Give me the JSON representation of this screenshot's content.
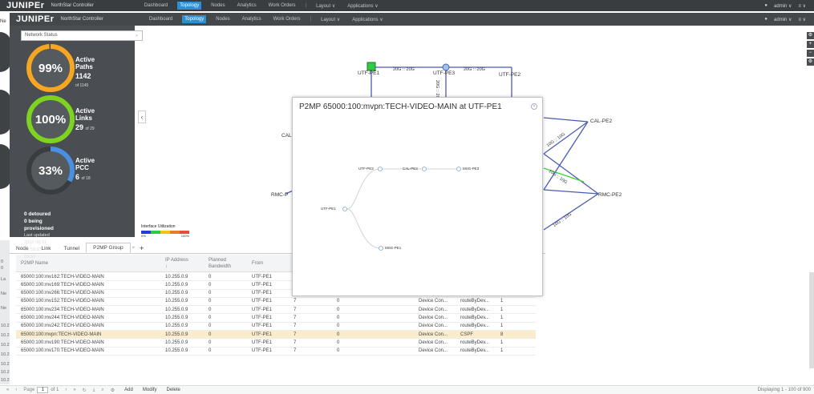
{
  "app": {
    "brand": "JUNIPEr",
    "brand_sub": "NorthStar Controller",
    "nav": [
      "Dashboard",
      "Topology",
      "Nodes",
      "Analytics",
      "Work Orders"
    ],
    "nav_active": "Topology",
    "layout_menu": "Layout ∨",
    "applications_menu": "Applications ∨",
    "user": "admin ∨",
    "menu_icon": "≡ ∨",
    "back_left_stub": "Ne"
  },
  "left_panel": {
    "select_label": "Network Status",
    "gauges": [
      {
        "pct_text": "99%",
        "pct": 99,
        "color": "#f5a623",
        "title": "Active Paths",
        "value": "1142",
        "of": "of 1145"
      },
      {
        "pct_text": "100%",
        "pct": 100,
        "color": "#7ed321",
        "title": "Active Links",
        "value": "29",
        "of": "of 29"
      },
      {
        "pct_text": "33%",
        "pct": 33,
        "color": "#4a90e2",
        "title": "Active PCC",
        "value": "6",
        "of": "of 18"
      }
    ],
    "detoured": "0 detoured",
    "provisioned": "0 being provisioned",
    "last_updated": "Last updated 2018-08-31 15:58:32 CEST"
  },
  "topology": {
    "nodes": [
      {
        "label": "UTF-PE1"
      },
      {
        "label": "UTF-PE3"
      },
      {
        "label": "UTF-PE2"
      },
      {
        "label": "CAL-PE2"
      },
      {
        "label": "RMC-PE2"
      },
      {
        "label": "CAL"
      },
      {
        "label": "RMC-P"
      }
    ],
    "link_labels": [
      "20G :: 20G",
      "20G :: 20G",
      "20G :: 20G",
      "10G :: 10G",
      "10G :: 10G",
      "10G :: 10G"
    ],
    "legend_title": "Interface Utilization",
    "legend_min": "0%",
    "legend_max": "100%",
    "legend_colors": [
      "#2b3bd6",
      "#2ecc40",
      "#f1c40f",
      "#e67e22",
      "#e74c3c"
    ]
  },
  "popup": {
    "title": "P2MP 65000:100:mvpn:TECH-VIDEO-MAIN at UTF-PE1",
    "tree": {
      "root": "UTF-PE1",
      "children": [
        "UTF-PE3",
        "CAL-PE3",
        "MSG-PE3",
        "MSG-PE1"
      ]
    }
  },
  "table": {
    "tabs": [
      "Node",
      "Link",
      "Tunnel",
      "P2MP Group"
    ],
    "add_tab": "+",
    "close_tab": "×",
    "columns": [
      "P2MP Name",
      "IP Address ↓",
      "Planned Bandwidth",
      "From"
    ],
    "rows": [
      [
        "65000:100:mv162:TECH-VIDEO-MAIN",
        "10.255.0.9",
        "0",
        "UTF-PE1",
        "",
        "",
        "",
        "",
        ""
      ],
      [
        "65000:100:mv169:TECH-VIDEO-MAIN",
        "10.255.0.9",
        "0",
        "UTF-PE1",
        "",
        "",
        "",
        "",
        ""
      ],
      [
        "65000:100:mv266:TECH-VIDEO-MAIN",
        "10.255.0.9",
        "0",
        "UTF-PE1",
        "7",
        "0",
        "Device Con...",
        "routeByDev...",
        "1"
      ],
      [
        "65000:100:mv152:TECH-VIDEO-MAIN",
        "10.255.0.9",
        "0",
        "UTF-PE1",
        "7",
        "0",
        "Device Con...",
        "routeByDev...",
        "1"
      ],
      [
        "65000:100:mv234:TECH-VIDEO-MAIN",
        "10.255.0.9",
        "0",
        "UTF-PE1",
        "7",
        "0",
        "Device Con...",
        "routeByDev...",
        "1"
      ],
      [
        "65000:100:mv244:TECH-VIDEO-MAIN",
        "10.255.0.9",
        "0",
        "UTF-PE1",
        "7",
        "0",
        "Device Con...",
        "routeByDev...",
        "1"
      ],
      [
        "65000:100:mv242:TECH-VIDEO-MAIN",
        "10.255.0.9",
        "0",
        "UTF-PE1",
        "7",
        "0",
        "Device Con...",
        "routeByDev...",
        "1"
      ],
      [
        "65000:100:mvpn:TECH-VIDEO-MAIN",
        "10.255.0.9",
        "0",
        "UTF-PE1",
        "7",
        "0",
        "Device Con...",
        "CSPF",
        "8"
      ],
      [
        "65000:100:mv190:TECH-VIDEO-MAIN",
        "10.255.0.9",
        "0",
        "UTF-PE1",
        "7",
        "0",
        "Device Con...",
        "routeByDev...",
        "1"
      ],
      [
        "65000:100:mv170:TECH-VIDEO-MAIN",
        "10.255.0.9",
        "0",
        "UTF-PE1",
        "7",
        "0",
        "Device Con...",
        "routeByDev...",
        "1"
      ]
    ],
    "selected_row": 7
  },
  "left_gutter": [
    "0",
    "0",
    "La",
    "Ne",
    "Ne",
    "10.2",
    "10.2",
    "10.2",
    "10.2",
    "10.2",
    "10.2",
    "10.2"
  ],
  "footer": {
    "page_label": "Page",
    "page_value": "1",
    "of_label": "of 1",
    "add": "Add",
    "modify": "Modify",
    "delete": "Delete",
    "displaying": "Displaying 1 - 100 of 900"
  }
}
